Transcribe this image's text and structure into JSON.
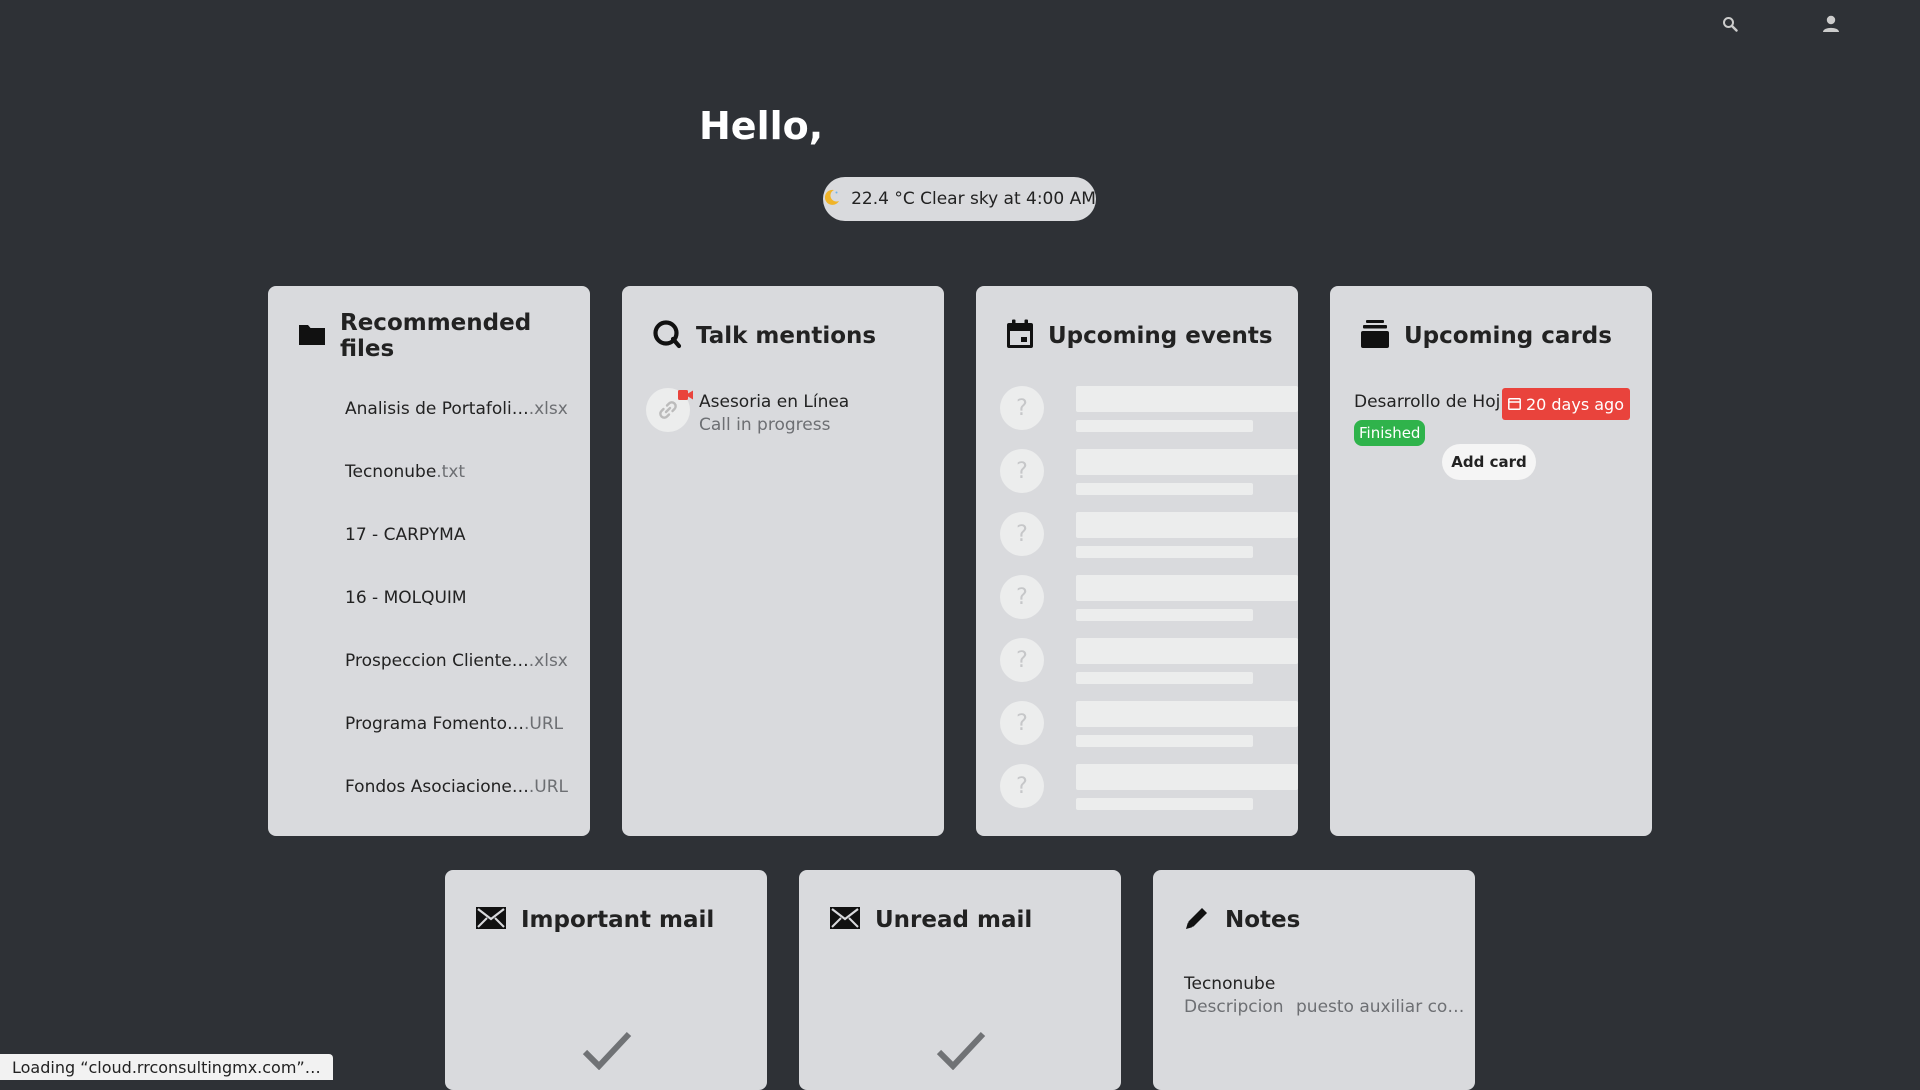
{
  "topbar": {
    "search_icon": "search-icon",
    "contacts_icon": "contacts-icon"
  },
  "greeting": "Hello,",
  "weather": {
    "text": "22.4 °C Clear sky at 4:00 AM",
    "icon": "moon-icon"
  },
  "panels": {
    "files": {
      "title": "Recommended files",
      "items": [
        {
          "name": "Analisis de Portafoli…",
          "ext": ".xlsx"
        },
        {
          "name": "Tecnonube",
          "ext": ".txt"
        },
        {
          "name": "17 - CARPYMA",
          "ext": ""
        },
        {
          "name": "16 - MOLQUIM",
          "ext": ""
        },
        {
          "name": "Prospeccion Cliente…",
          "ext": ".xlsx"
        },
        {
          "name": "Programa Fomento…",
          "ext": ".URL"
        },
        {
          "name": "Fondos Asociacione…",
          "ext": ".URL"
        }
      ]
    },
    "talk": {
      "title": "Talk mentions",
      "item": {
        "name": "Asesoria en Línea",
        "status": "Call in progress"
      }
    },
    "events": {
      "title": "Upcoming events",
      "placeholder_glyph": "?"
    },
    "cards": {
      "title": "Upcoming cards",
      "item": {
        "name": "Desarrollo de Hoj…",
        "due": "20 days ago",
        "label": "Finished"
      },
      "add_label": "Add card"
    },
    "important_mail": {
      "title": "Important mail"
    },
    "unread_mail": {
      "title": "Unread mail"
    },
    "notes": {
      "title": "Notes",
      "item": {
        "title": "Tecnonube",
        "category": "Descripcion",
        "excerpt": "puesto auxiliar co…"
      }
    }
  },
  "statusbar": {
    "text": "Loading “cloud.rrconsultingmx.com”…"
  },
  "colors": {
    "background": "#2e3136",
    "panel": "#d9dadd",
    "due_badge": "#e9433c",
    "finished_badge": "#2fb34b",
    "talk_call": "#e9433c"
  }
}
